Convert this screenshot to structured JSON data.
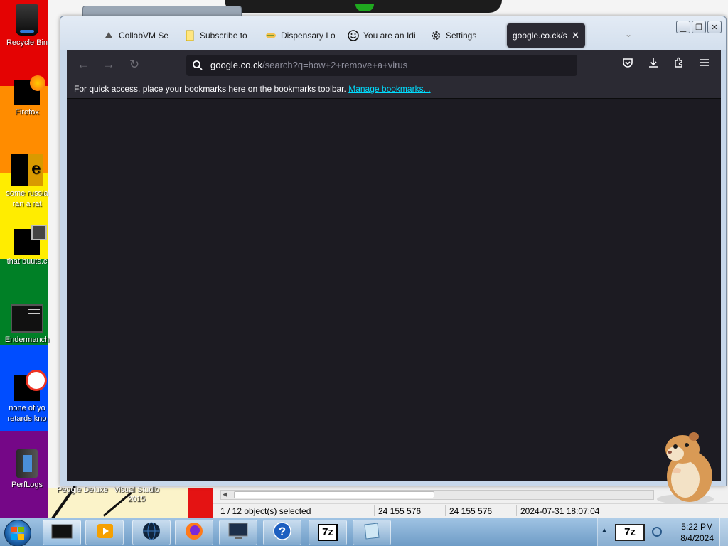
{
  "desktop": {
    "rainbow_colors": [
      "#e40303",
      "#ff8c00",
      "#ffed00",
      "#008026",
      "#004dff",
      "#750787"
    ],
    "icons": [
      {
        "label": "Recycle Bin",
        "icon": "recycle-bin-icon"
      },
      {
        "label": "Firefox",
        "icon": "firefox-icon"
      },
      {
        "label_line1": "some russia",
        "label_line2": "ran a rat",
        "icon": "notepad-icon"
      },
      {
        "label": "that buuts.c",
        "icon": "folder-stack-icon"
      },
      {
        "label": "Endermanch",
        "icon": "terminal-icon"
      },
      {
        "label_line1": "none of yo",
        "label_line2": "retards kno",
        "icon": "app-icon"
      },
      {
        "label": "PerfLogs",
        "icon": "folder-icon"
      }
    ],
    "bottom_labels": {
      "peggle": "Peggle Deluxe",
      "visual_studio_line1": "Visual Studio",
      "visual_studio_line2": "2015"
    }
  },
  "browser": {
    "tabs": [
      {
        "title": "CollabVM Se",
        "icon": "collabvm-icon"
      },
      {
        "title": "Subscribe to",
        "icon": "page-icon"
      },
      {
        "title": "Dispensary Lo",
        "icon": "leaf-icon"
      },
      {
        "title": "You are an Idi",
        "icon": "smiley-icon"
      },
      {
        "title": "Settings",
        "icon": "gear-icon"
      },
      {
        "title": "google.co.ck/s",
        "icon": "none",
        "active": true
      }
    ],
    "url_host": "google.co.ck",
    "url_rest": "/search?q=how+2+remove+a+virus",
    "bookmarks_message": "For quick access, place your bookmarks here on the bookmarks toolbar.",
    "manage_bookmarks_link": "Manage bookmarks...",
    "accent_link_color": "#00ddff",
    "content_bg": "#1c1b22"
  },
  "explorer_status": {
    "selection": "1 / 12 object(s) selected",
    "size1": "24 155 576",
    "size2": "24 155 576",
    "modified": "2024-07-31 18:07:04"
  },
  "taskbar": {
    "clock_time": "5:22 PM",
    "clock_date": "8/4/2024",
    "buttons": [
      {
        "icon": "window-app-icon",
        "active": true
      },
      {
        "icon": "media-player-icon"
      },
      {
        "icon": "browser-globe-icon"
      },
      {
        "icon": "firefox-icon"
      },
      {
        "icon": "monitor-icon"
      },
      {
        "icon": "help-icon"
      },
      {
        "icon": "sevenzip-icon",
        "text": "7z"
      },
      {
        "icon": "notepad-icon"
      }
    ]
  }
}
